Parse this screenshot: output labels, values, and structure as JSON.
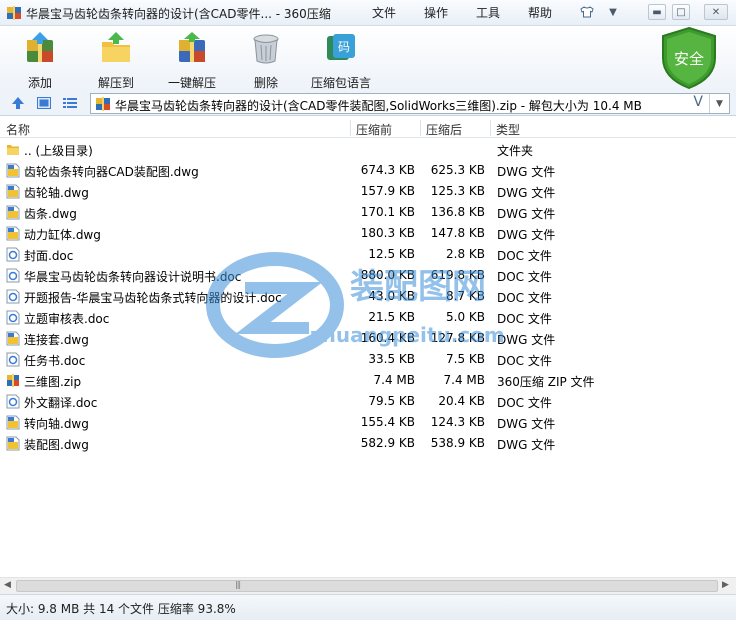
{
  "window": {
    "title": "华晨宝马齿轮齿条转向器的设计(含CAD零件... - 360压缩",
    "menu": [
      "文件",
      "操作",
      "工具",
      "帮助"
    ]
  },
  "toolbar": {
    "buttons": [
      {
        "label": "添加",
        "icon": "add-archive-icon"
      },
      {
        "label": "解压到",
        "icon": "extract-to-icon"
      },
      {
        "label": "一键解压",
        "icon": "one-click-extract-icon"
      },
      {
        "label": "删除",
        "icon": "trash-icon"
      },
      {
        "label": "压缩包语言",
        "icon": "archive-language-icon"
      }
    ],
    "security_badge": "安全",
    "language_glyph": "码"
  },
  "address": {
    "path": "华晨宝马齿轮齿条转向器的设计(含CAD零件装配图,SolidWorks三维图).zip - 解包大小为 10.4 MB"
  },
  "columns": {
    "name": "名称",
    "compressed": "压缩前",
    "uncompressed": "压缩后",
    "type": "类型"
  },
  "files": [
    {
      "name": ".. (上级目录)",
      "compressed": "",
      "uncompressed": "",
      "type": "文件夹",
      "kind": "folder"
    },
    {
      "name": "齿轮齿条转向器CAD装配图.dwg",
      "compressed": "674.3 KB",
      "uncompressed": "625.3 KB",
      "type": "DWG 文件",
      "kind": "dwg"
    },
    {
      "name": "齿轮轴.dwg",
      "compressed": "157.9 KB",
      "uncompressed": "125.3 KB",
      "type": "DWG 文件",
      "kind": "dwg"
    },
    {
      "name": "齿条.dwg",
      "compressed": "170.1 KB",
      "uncompressed": "136.8 KB",
      "type": "DWG 文件",
      "kind": "dwg"
    },
    {
      "name": "动力缸体.dwg",
      "compressed": "180.3 KB",
      "uncompressed": "147.8 KB",
      "type": "DWG 文件",
      "kind": "dwg"
    },
    {
      "name": "封面.doc",
      "compressed": "12.5 KB",
      "uncompressed": "2.8 KB",
      "type": "DOC 文件",
      "kind": "doc"
    },
    {
      "name": "华晨宝马齿轮齿条转向器设计说明书.doc",
      "compressed": "880.0 KB",
      "uncompressed": "619.8 KB",
      "type": "DOC 文件",
      "kind": "doc"
    },
    {
      "name": "开题报告-华晨宝马齿轮齿条式转向器的设计.doc",
      "compressed": "43.0 KB",
      "uncompressed": "8.7 KB",
      "type": "DOC 文件",
      "kind": "doc"
    },
    {
      "name": "立题审核表.doc",
      "compressed": "21.5 KB",
      "uncompressed": "5.0 KB",
      "type": "DOC 文件",
      "kind": "doc"
    },
    {
      "name": "连接套.dwg",
      "compressed": "160.4 KB",
      "uncompressed": "127.8 KB",
      "type": "DWG 文件",
      "kind": "dwg"
    },
    {
      "name": "任务书.doc",
      "compressed": "33.5 KB",
      "uncompressed": "7.5 KB",
      "type": "DOC 文件",
      "kind": "doc"
    },
    {
      "name": "三维图.zip",
      "compressed": "7.4 MB",
      "uncompressed": "7.4 MB",
      "type": "360压缩 ZIP 文件",
      "kind": "zip"
    },
    {
      "name": "外文翻译.doc",
      "compressed": "79.5 KB",
      "uncompressed": "20.4 KB",
      "type": "DOC 文件",
      "kind": "doc"
    },
    {
      "name": "转向轴.dwg",
      "compressed": "155.4 KB",
      "uncompressed": "124.3 KB",
      "type": "DWG 文件",
      "kind": "dwg"
    },
    {
      "name": "装配图.dwg",
      "compressed": "582.9 KB",
      "uncompressed": "538.9 KB",
      "type": "DWG 文件",
      "kind": "dwg"
    }
  ],
  "watermark": {
    "title": "装配图网",
    "url": "zhuangpeitu.com"
  },
  "status": {
    "text": "大小: 9.8 MB 共 14 个文件 压缩率 93.8%"
  },
  "colors": {
    "accent": "#3a7bd5",
    "shield_green": "#3f9b2e",
    "watermark_blue": "#3d8fd8"
  }
}
